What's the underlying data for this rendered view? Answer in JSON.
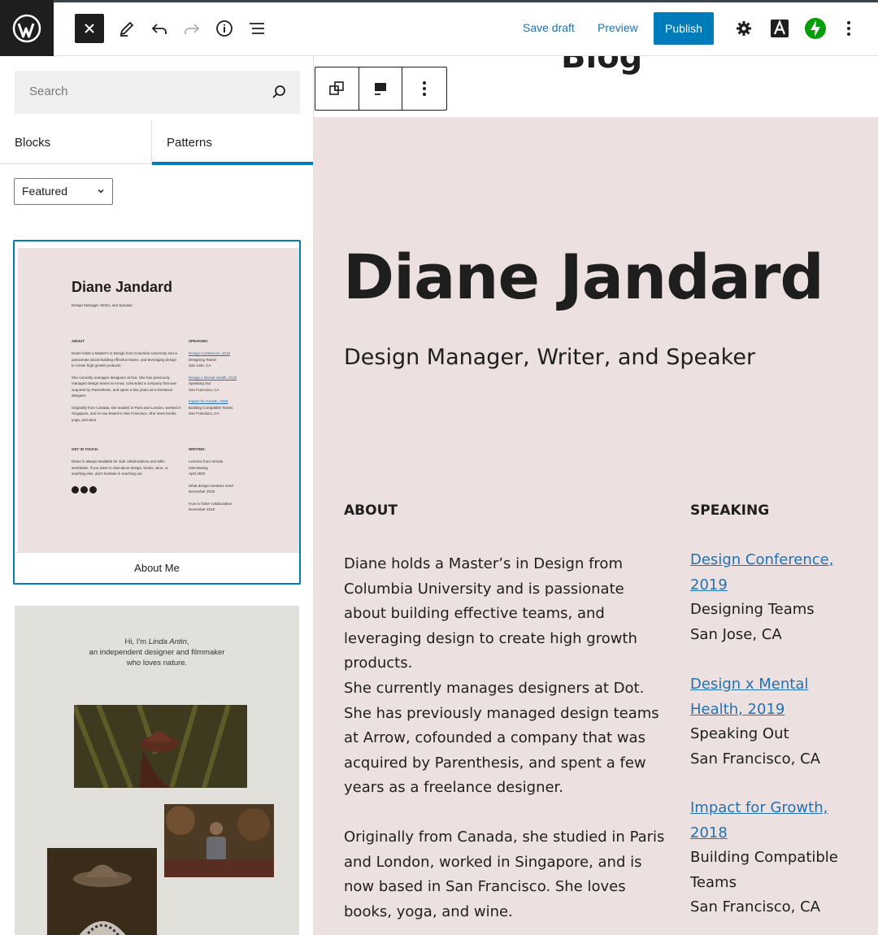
{
  "toolbar": {
    "save_draft": "Save draft",
    "preview": "Preview",
    "publish": "Publish"
  },
  "sidebar": {
    "search_placeholder": "Search",
    "tabs": [
      "Blocks",
      "Patterns"
    ],
    "category": "Featured",
    "patterns": [
      {
        "label": "About Me",
        "preview": {
          "title": "Diane Jandard",
          "subtitle": "Design Manager, Writer, and Speaker",
          "about_head": "ABOUT",
          "about_lines": [
            "Diane holds a Master's in Design from Columbia University and is",
            "passionate about building effective teams, and leveraging design",
            "to create high growth products.",
            "",
            "She currently manages designers at Dot. She has previously",
            "managed design teams at Arrow, cofounded a company that was",
            "acquired by Parenthesis, and spent a few years as a freelance",
            "designer.",
            "",
            "Originally from Canada, she studied in Paris and London, worked in",
            "Singapore, and is now based in San Francisco. She loves books,",
            "yoga, and wine."
          ],
          "speaking_head": "SPEAKING",
          "speaking": [
            {
              "link": "Design Conference, 2019",
              "lines": [
                "Designing Teams",
                "San Jose, CA"
              ]
            },
            {
              "link": "Design x Mental Health, 2019",
              "lines": [
                "Speaking Out",
                "San Francisco, CA"
              ]
            },
            {
              "link": "Impact for Growth, 2018",
              "lines": [
                "Building Compatible Teams",
                "San Francisco, CA"
              ]
            }
          ],
          "contact_head": "GET IN TOUCH",
          "contact_lines": [
            "Diane is always available for side collaborations and talks",
            "worldwide. If you want to chat about design, books, wine, or",
            "anything else, don't hesitate in reaching out."
          ],
          "writing_head": "WRITING:",
          "writing": [
            [
              "Lessons from remote",
              "interviewing",
              "April 2020"
            ],
            [
              "What design mentees need",
              "December 2019"
            ],
            [
              "How to foster collaboration",
              "November 2019"
            ]
          ]
        }
      },
      {
        "preview": {
          "intro_1": "Hi, I'm ",
          "intro_name": "Linda Antin",
          "intro_2": ",",
          "intro_3": "an independent designer and filmmaker",
          "intro_4": "who loves nature."
        }
      }
    ]
  },
  "canvas": {
    "blog_title": "Blog",
    "name": "Diane Jandard",
    "tagline": "Design Manager, Writer, and Speaker",
    "about_head": "ABOUT",
    "about_paragraphs": [
      "Diane holds a Master’s in Design from Columbia University and is passionate about building effective teams, and leveraging design to create high growth products.",
      "She currently manages designers at Dot. She has previously managed design teams at Arrow, cofounded a company that was acquired by Parenthesis, and spent a few years as a freelance designer.",
      "Originally from Canada, she studied in Paris and London, worked in Singapore, and is now based in San Francisco. She loves books, yoga, and wine."
    ],
    "speaking_head": "SPEAKING",
    "speaking": [
      {
        "link_1": "Design Conference,",
        "link_2": "2019",
        "line_1": "Designing Teams",
        "line_2": "San Jose, CA"
      },
      {
        "link_1": "Design x Mental",
        "link_2": "Health, 2019",
        "line_1": "Speaking Out",
        "line_2": "San Francisco, CA"
      },
      {
        "link_1": "Impact for Growth,",
        "link_2": "2018",
        "line_1": "Building Compatible",
        "line_2": "Teams",
        "line_3": "San Francisco, CA"
      }
    ]
  },
  "colors": {
    "accent": "#007cba",
    "pattern_bg": "#ece1e0",
    "link": "#2271b1"
  }
}
